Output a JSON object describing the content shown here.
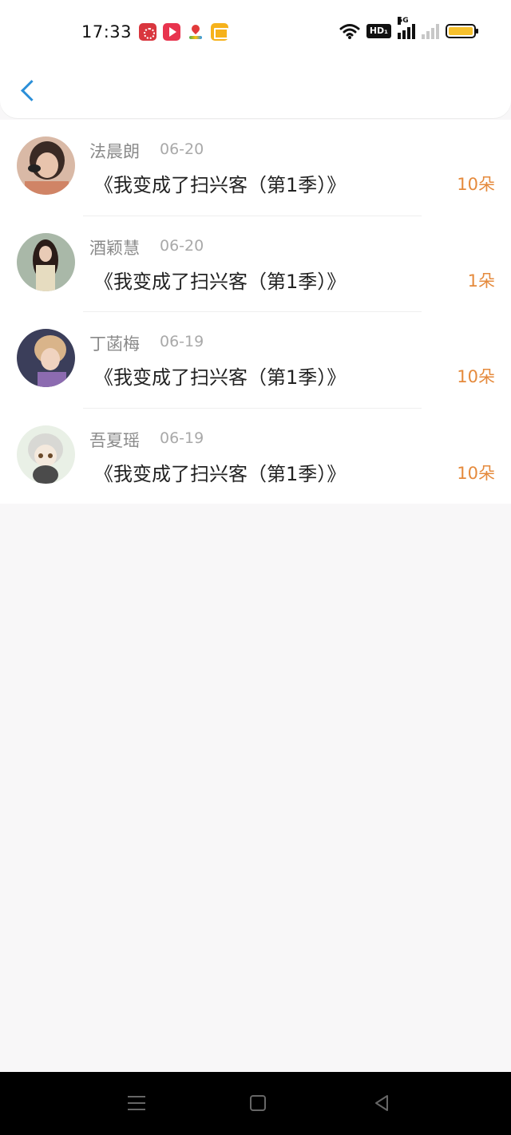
{
  "status_bar": {
    "time": "17:33",
    "app_icons": [
      "flower-app-icon",
      "video-play-icon",
      "map-pin-icon",
      "mail-icon"
    ],
    "system_icons": [
      "wifi-icon",
      "hd-icon",
      "signal-5g-icon",
      "signal-icon",
      "battery-icon"
    ],
    "hd_label": "HD₁",
    "network_label": "5G",
    "battery_color": "#f6c02c"
  },
  "header": {
    "back_icon": "chevron-left-icon",
    "accent": "#2b8fd8"
  },
  "gifts": {
    "count_color": "#e58a3c",
    "items": [
      {
        "name": "法晨朗",
        "date": "06-20",
        "title": "《我变成了扫兴客（第1季）》",
        "count": "10朵"
      },
      {
        "name": "酒颖慧",
        "date": "06-20",
        "title": "《我变成了扫兴客（第1季）》",
        "count": "1朵"
      },
      {
        "name": "丁菡梅",
        "date": "06-19",
        "title": "《我变成了扫兴客（第1季）》",
        "count": "10朵"
      },
      {
        "name": "吾夏瑶",
        "date": "06-19",
        "title": "《我变成了扫兴客（第1季）》",
        "count": "10朵"
      }
    ]
  },
  "nav_bar": {
    "icons": [
      "menu-icon",
      "home-icon",
      "back-triangle-icon"
    ]
  }
}
